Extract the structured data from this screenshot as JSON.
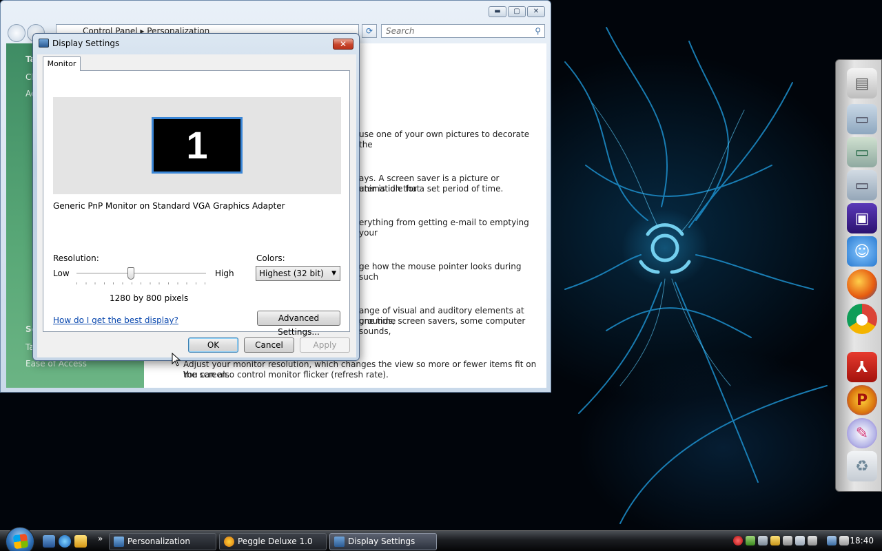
{
  "control_panel": {
    "breadcrumb": [
      "Control Panel",
      "Personalization"
    ],
    "search_placeholder": "Search",
    "left_items": [
      "Ta",
      "Ch",
      "Ad",
      "Se",
      "Ta",
      "Ease of Access"
    ],
    "main_lines": [
      "use one of your own pictures to decorate the",
      "ays. A screen saver is a picture or animation that",
      "uter is idle for a set period of time.",
      "erything from getting e-mail to emptying your",
      "ge how the mouse pointer looks during such",
      "ange of visual and auditory elements at one time",
      "grounds, screen savers, some computer sounds,",
      "Adjust your monitor resolution, which changes the view so more or fewer items fit on the screen.",
      "You can also control monitor flicker (refresh rate)."
    ]
  },
  "dialog": {
    "title": "Display Settings",
    "close_label": "✕",
    "tab": "Monitor",
    "monitor_number": "1",
    "adapter": "Generic PnP Monitor on Standard VGA Graphics Adapter",
    "resolution_label": "Resolution:",
    "low": "Low",
    "high": "High",
    "resolution_position": 0.42,
    "resolution_value": "1280 by 800 pixels",
    "colors_label": "Colors:",
    "colors_value": "Highest (32 bit)",
    "help_link": "How do I get the best display?",
    "advanced_button": "Advanced Settings...",
    "ok_button": "OK",
    "cancel_button": "Cancel",
    "apply_button": "Apply"
  },
  "taskbar": {
    "tasks": [
      "Personalization",
      "Peggle Deluxe 1.0",
      "Display Settings"
    ],
    "clock": "18:40",
    "overflow": "»"
  },
  "colors": {
    "accent": "#3a86d6",
    "link": "#0645ad",
    "cp_sidebar": "#59a877"
  }
}
